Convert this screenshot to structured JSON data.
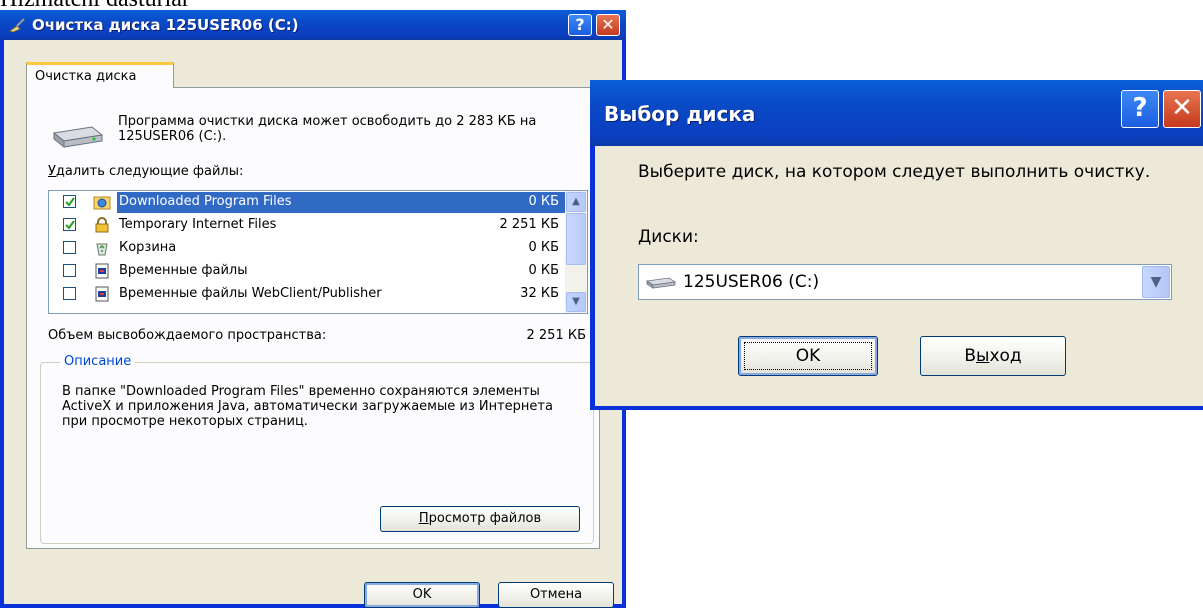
{
  "caption": "Hizmatchi dasturlar",
  "cleanup_window": {
    "title": "Очистка диска 125USER06 (C:)",
    "help_label": "?",
    "close_label": "✕",
    "tab_label": "Очистка диска",
    "intro_text": "Программа очистки диска может освободить до 2 283 КБ на 125USER06 (C:).",
    "delete_label_accel": "У",
    "delete_label_rest": "далить следующие файлы:",
    "files": [
      {
        "name": "Downloaded Program Files",
        "size": "0 КБ",
        "checked": true,
        "selected": true,
        "icon": "folder-globe-icon"
      },
      {
        "name": "Temporary Internet Files",
        "size": "2 251 КБ",
        "checked": true,
        "selected": false,
        "icon": "lock-icon"
      },
      {
        "name": "Корзина",
        "size": "0 КБ",
        "checked": false,
        "selected": false,
        "icon": "recycle-bin-icon"
      },
      {
        "name": "Временные файлы",
        "size": "0 КБ",
        "checked": false,
        "selected": false,
        "icon": "temp-file-icon"
      },
      {
        "name": "Временные файлы WebClient/Publisher",
        "size": "32 КБ",
        "checked": false,
        "selected": false,
        "icon": "webclient-file-icon"
      }
    ],
    "space_label": "Объем высвобождаемого пространства:",
    "space_value": "2 251 КБ",
    "description_title": "Описание",
    "description_text": "В папке \"Downloaded Program Files\" временно сохраняются элементы ActiveX и приложения Java, автоматически загружаемые из Интернета при просмотре некоторых страниц.",
    "view_files_accel": "П",
    "view_files_rest": "росмотр файлов",
    "ok_label": "OK",
    "cancel_label": "Отмена"
  },
  "select_drive_window": {
    "title": "Выбор диска",
    "help_label": "?",
    "close_label": "✕",
    "prompt": "Выберите диск, на котором следует выполнить очистку.",
    "disks_label_accel": "Д",
    "disks_label_rest": "иски:",
    "selected_drive": "125USER06 (C:)",
    "ok_label": "OK",
    "exit_label_pre": "В",
    "exit_label_accel": "ы",
    "exit_label_rest": "ход"
  },
  "colors": {
    "titlebar": "#0a49c5",
    "selection": "#316ac5",
    "window_bg": "#ece9d8",
    "groupbox_title": "#0046d5"
  }
}
